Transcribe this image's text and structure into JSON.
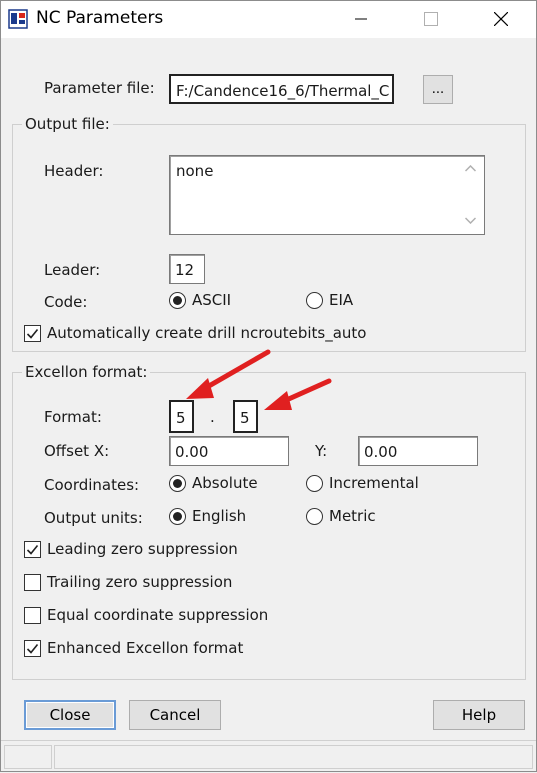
{
  "window": {
    "title": "NC Parameters",
    "controls": [
      "minimize-icon",
      "maximize-icon",
      "close-icon"
    ]
  },
  "parameter_file": {
    "label": "Parameter file:",
    "value": "F:/Candence16_6/Thermal_C",
    "browse_label": "..."
  },
  "output_file": {
    "group_title": "Output file:",
    "header_label": "Header:",
    "header_value": "none",
    "leader_label": "Leader:",
    "leader_value": "12",
    "code_label": "Code:",
    "code_options": [
      "ASCII",
      "EIA"
    ],
    "code_selected": "ASCII",
    "auto_create_label": "Automatically create drill ncroutebits_auto",
    "auto_create_checked": true
  },
  "excellon": {
    "group_title": "Excellon format:",
    "format_label": "Format:",
    "format_integer": "5",
    "format_separator": ".",
    "format_decimal": "5",
    "offset_x_label": "Offset X:",
    "offset_x_value": "0.00",
    "offset_y_label": "Y:",
    "offset_y_value": "0.00",
    "coordinates_label": "Coordinates:",
    "coordinates_options": [
      "Absolute",
      "Incremental"
    ],
    "coordinates_selected": "Absolute",
    "output_units_label": "Output units:",
    "output_units_options": [
      "English",
      "Metric"
    ],
    "output_units_selected": "English",
    "checkboxes": [
      {
        "label": "Leading zero suppression",
        "checked": true
      },
      {
        "label": "Trailing zero suppression",
        "checked": false
      },
      {
        "label": "Equal coordinate suppression",
        "checked": false
      },
      {
        "label": "Enhanced Excellon format",
        "checked": true
      }
    ]
  },
  "buttons": {
    "close": "Close",
    "cancel": "Cancel",
    "help": "Help"
  },
  "annotation": {
    "arrow_color": "#e02020",
    "arrow_count": 2
  },
  "colors": {
    "accent": "#6a9bd6"
  }
}
